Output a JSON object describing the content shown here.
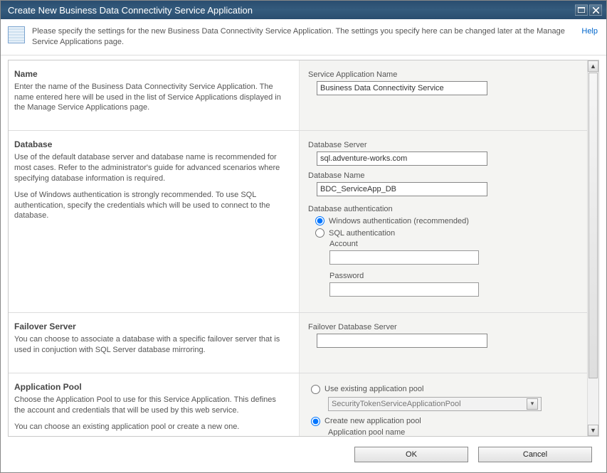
{
  "window": {
    "title": "Create New Business Data Connectivity Service Application"
  },
  "info": {
    "text": "Please specify the settings for the new Business Data Connectivity Service Application. The settings you specify here can be changed later at the Manage Service Applications page.",
    "help": "Help"
  },
  "sections": {
    "name": {
      "title": "Name",
      "desc": "Enter the name of the Business Data Connectivity Service Application. The name entered here will be used in the list of Service Applications displayed in the Manage Service Applications page.",
      "field_label": "Service Application Name",
      "value": "Business Data Connectivity Service"
    },
    "database": {
      "title": "Database",
      "desc1": "Use of the default database server and database name is recommended for most cases. Refer to the administrator's guide for advanced scenarios where specifying database information is required.",
      "desc2": "Use of Windows authentication is strongly recommended. To use SQL authentication, specify the credentials which will be used to connect to the database.",
      "server_label": "Database Server",
      "server_value": "sql.adventure-works.com",
      "dbname_label": "Database Name",
      "dbname_value": "BDC_ServiceApp_DB",
      "auth_label": "Database authentication",
      "auth_windows": "Windows authentication (recommended)",
      "auth_sql": "SQL authentication",
      "account_label": "Account",
      "account_value": "",
      "password_label": "Password",
      "password_value": ""
    },
    "failover": {
      "title": "Failover Server",
      "desc": "You can choose to associate a database with a specific failover server that is used in conjuction with SQL Server database mirroring.",
      "field_label": "Failover Database Server",
      "value": ""
    },
    "apppool": {
      "title": "Application Pool",
      "desc1": "Choose the Application Pool to use for this Service Application.  This defines the account and credentials that will be used by this web service.",
      "desc2": "You can choose an existing application pool or create a new one.",
      "use_existing": "Use existing application pool",
      "existing_value": "SecurityTokenServiceApplicationPool",
      "create_new": "Create new application pool",
      "poolname_label": "Application pool name"
    }
  },
  "footer": {
    "ok": "OK",
    "cancel": "Cancel"
  }
}
